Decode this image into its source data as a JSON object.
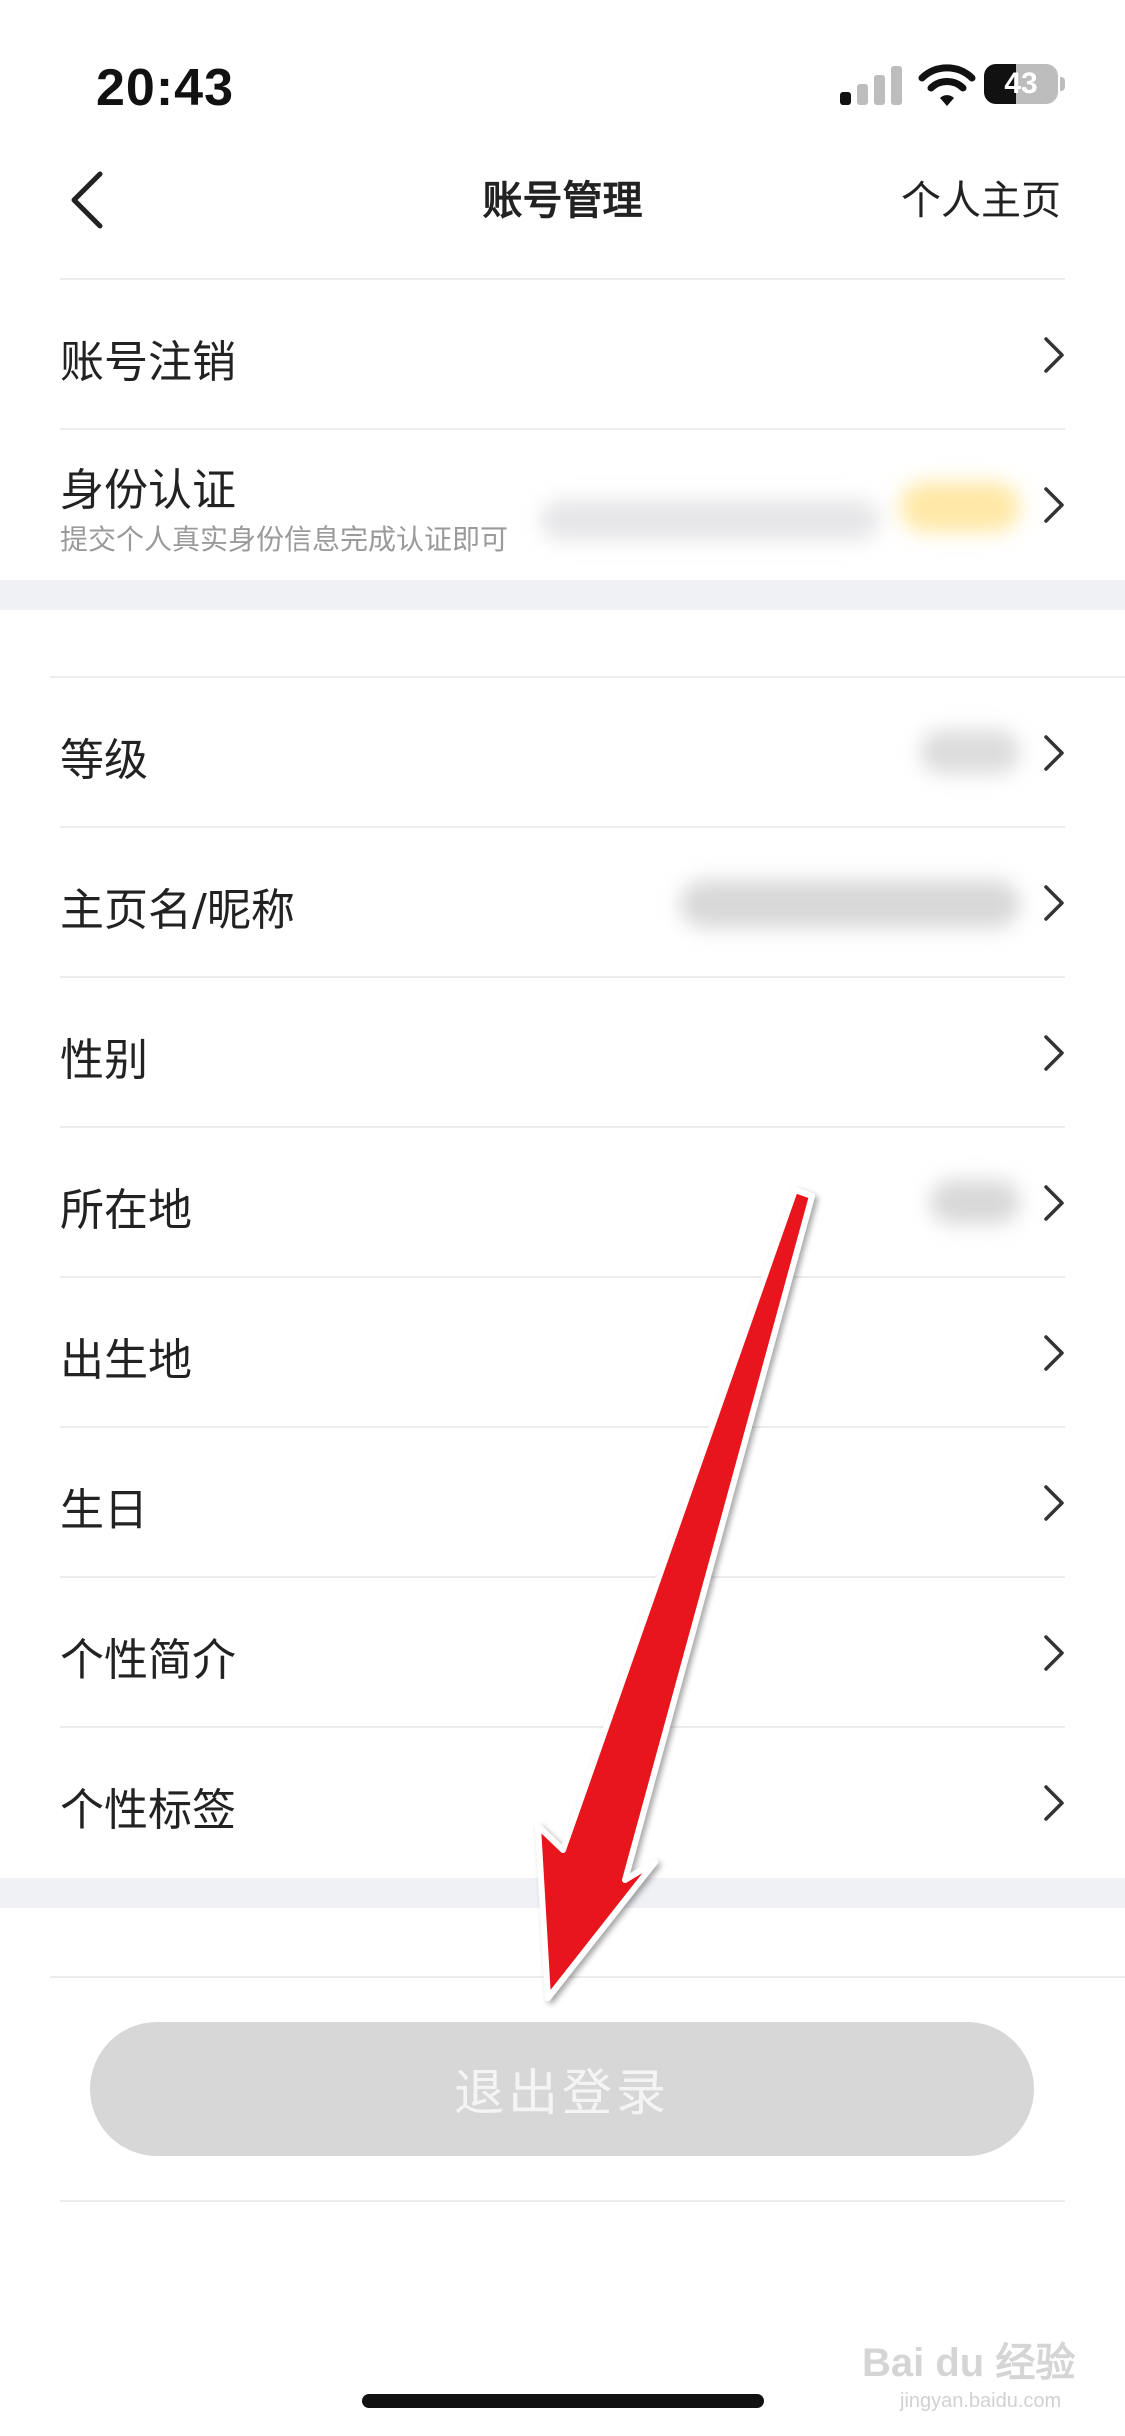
{
  "status_bar": {
    "time": "20:43",
    "battery": "43",
    "battery_level": 0.43
  },
  "nav": {
    "title": "账号管理",
    "right_link": "个人主页",
    "back_icon": "chevron-left-icon"
  },
  "section1": {
    "items": [
      {
        "label": "账号注销"
      },
      {
        "label": "身份认证",
        "subtitle": "提交个人真实身份信息完成认证即可"
      }
    ]
  },
  "section2": {
    "items": [
      {
        "label": "等级"
      },
      {
        "label": "主页名/昵称"
      },
      {
        "label": "性别"
      },
      {
        "label": "所在地"
      },
      {
        "label": "出生地"
      },
      {
        "label": "生日"
      },
      {
        "label": "个性简介"
      },
      {
        "label": "个性标签"
      }
    ]
  },
  "logout": {
    "label": "退出登录"
  },
  "watermark": {
    "brand": "Bai du 经验",
    "url": "jingyan.baidu.com"
  },
  "colors": {
    "section_gap": "#eff1f5",
    "logout_bg": "#d7d7d7",
    "arrow": "#e8151b"
  }
}
